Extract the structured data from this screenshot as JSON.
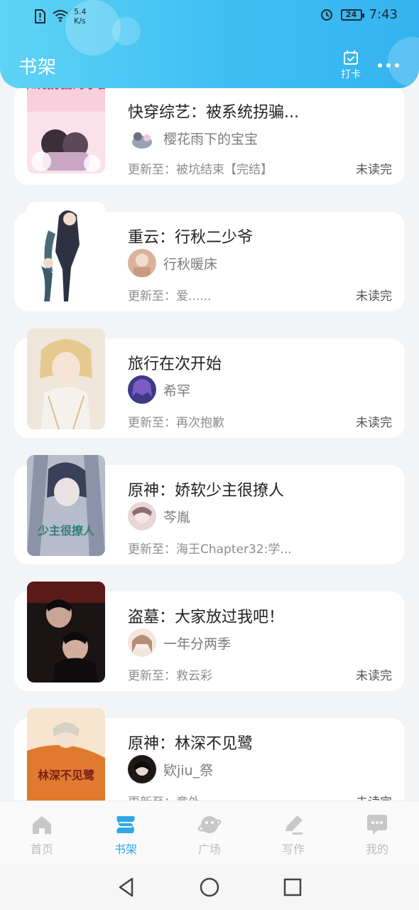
{
  "status_bar": {
    "speed_value": "5.4",
    "speed_unit": "K/s",
    "battery": "24",
    "time": "7:43"
  },
  "header": {
    "title": "书架",
    "checkin_label": "打卡"
  },
  "books": [
    {
      "title": "快穿综艺：被系统拐骗...",
      "author": "樱花雨下的宝宝",
      "update": "更新至：被坑结束【完结】",
      "status": "未读完",
      "cover_text": "被系统拐骗的小团宠"
    },
    {
      "title": "重云：行秋二少爷",
      "author": "行秋暖床",
      "update": "更新至：爱......",
      "status": "未读完",
      "cover_text": ""
    },
    {
      "title": "旅行在次开始",
      "author": "希罕",
      "update": "更新至：再次抱歉",
      "status": "未读完",
      "cover_text": ""
    },
    {
      "title": "原神：娇软少主很撩人",
      "author": "芩胤",
      "update": "更新至：海王Chapter32:学...",
      "status": "",
      "cover_text": "少主很撩人"
    },
    {
      "title": "盗墓：大家放过我吧！",
      "author": "一年分两季",
      "update": "更新至：救云彩",
      "status": "未读完",
      "cover_text": ""
    },
    {
      "title": "原神：林深不见鹭",
      "author": "欵jiu_祭",
      "update": "更新至：意外",
      "status": "未读完",
      "cover_text": "林深不见鹭"
    }
  ],
  "bottom_nav": [
    {
      "label": "首页",
      "icon": "home-icon",
      "active": false
    },
    {
      "label": "书架",
      "icon": "bookshelf-icon",
      "active": true
    },
    {
      "label": "广场",
      "icon": "planet-icon",
      "active": false
    },
    {
      "label": "写作",
      "icon": "pen-icon",
      "active": false
    },
    {
      "label": "我的",
      "icon": "chat-bubble-icon",
      "active": false
    }
  ],
  "colors": {
    "header_gradient_start": "#5ed3f4",
    "header_gradient_end": "#35b3f0",
    "active_tab": "#2fa8e8",
    "inactive_tab": "#bdbdbd",
    "background": "#f3f4f6"
  }
}
